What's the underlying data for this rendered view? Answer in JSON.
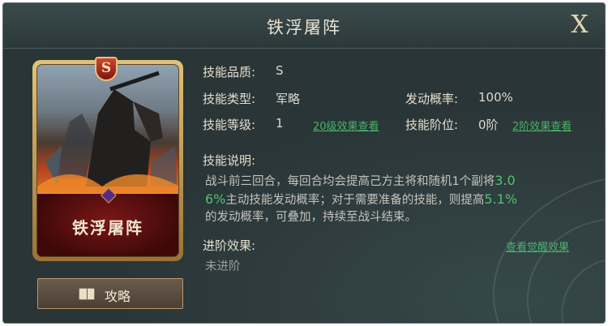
{
  "window": {
    "title": "铁浮屠阵",
    "close_label": "X"
  },
  "card": {
    "name": "铁浮屠阵",
    "rank": "S"
  },
  "guide_button": {
    "label": "攻略"
  },
  "info": {
    "quality_label": "技能品质:",
    "quality_value": "S",
    "type_label": "技能类型:",
    "type_value": "军略",
    "rate_label": "发动概率:",
    "rate_value": "100%",
    "level_label": "技能等级:",
    "level_value": "1",
    "level_link": "20级效果查看",
    "stage_label": "技能阶位:",
    "stage_value": "0阶",
    "stage_link": "2阶效果查看"
  },
  "description": {
    "label": "技能说明:",
    "part1": "战斗前三回合，每回合均会提高己方主将和随机1个副将",
    "hl1": "3.0",
    "hl1b": "6%",
    "part2": "主动技能发动概率；对于需要准备的技能，则提高",
    "hl2": "5.1%",
    "part3": "的发动概率，可叠加，持续至战斗结束。"
  },
  "advance": {
    "label": "进阶效果:",
    "link": "查看觉醒效果",
    "value": "未进阶"
  }
}
